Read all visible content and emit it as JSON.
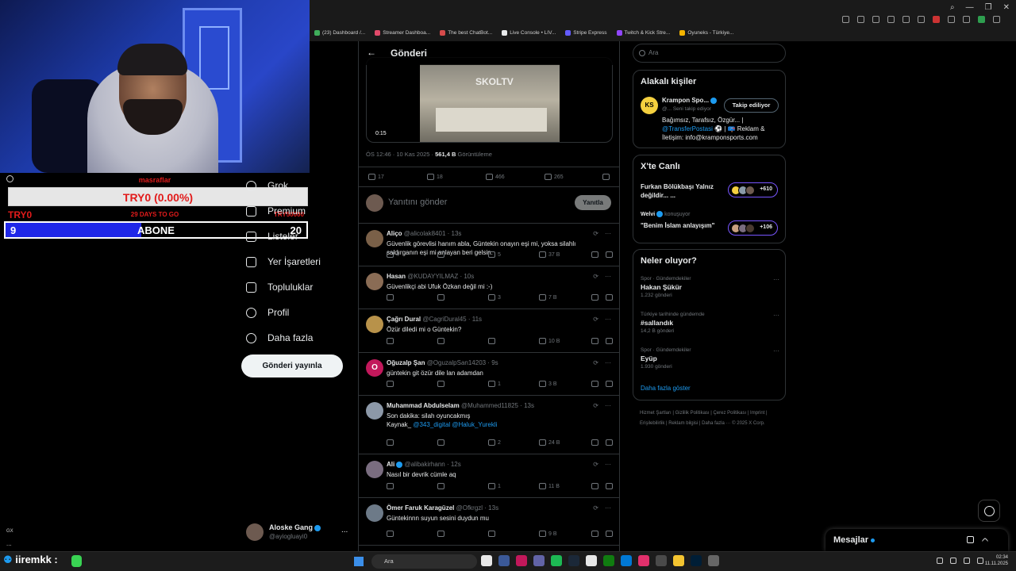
{
  "browser": {
    "bookmarks": [
      {
        "label": "(23) Dashboard /...",
        "color": "#3fae5a"
      },
      {
        "label": "Streamer Dashboa...",
        "color": "#e14a6a"
      },
      {
        "label": "The best ChatBot...",
        "color": "#d64b4b"
      },
      {
        "label": "Live Console • LIV...",
        "color": "#e7e9ea"
      },
      {
        "label": "Stripe Express",
        "color": "#635bff"
      },
      {
        "label": "Twitch & Kick Stre...",
        "color": "#9146ff"
      },
      {
        "label": "Oyuneks - Türkiye...",
        "color": "#f4b400"
      }
    ]
  },
  "overlay": {
    "goal_small": "masraflar",
    "goal_bar": "TRY0 (0.00%)",
    "goal_left": "TRY0",
    "goal_mid": "29 DAYS TO GO",
    "goal_right": "TRY50000",
    "sub_left": "9",
    "sub_mid": "ABONE",
    "sub_right": "20",
    "sub_progress": 0.45
  },
  "nav": {
    "items": [
      {
        "label": "Grok",
        "icon": "grok-icon"
      },
      {
        "label": "Premium",
        "icon": "x-icon"
      },
      {
        "label": "Listeler",
        "icon": "list-icon"
      },
      {
        "label": "Yer İşaretleri",
        "icon": "bookmark-icon"
      },
      {
        "label": "Topluluklar",
        "icon": "communities-icon"
      },
      {
        "label": "Profil",
        "icon": "profile-icon"
      },
      {
        "label": "Daha fazla",
        "icon": "more-icon"
      }
    ],
    "post_button": "Gönderi yayınla",
    "account_name": "Aloske Gang",
    "account_handle": "@ayiogluayi0",
    "account_more": "..."
  },
  "main": {
    "title": "Gönderi",
    "video_time": "0:15",
    "video_watermark": "SKOLTV",
    "meta_time": "ÖS 12:46 · 10 Kas 2025 · ",
    "meta_views": "561,4 B",
    "meta_views_label": " Görüntüleme",
    "stats": {
      "replies": "17",
      "reposts": "18",
      "likes": "466",
      "bookmarks": "265"
    },
    "reply_placeholder": "Yanıtını gönder",
    "reply_button": "Yanıtla",
    "replies": [
      {
        "name": "Aliço",
        "handle": "@alicolak8401 · 13s",
        "text": "Güvenlik görevlisi hanım abla, Güntekin onayın eşi mi, yoksa silahlı saldırganın eşi mi anlayan beri gelsin.",
        "replies": "4",
        "likes": "5",
        "views": "37 B",
        "avatar": "#7a6048"
      },
      {
        "name": "Hasan",
        "handle": "@KUDAYYILMAZ · 10s",
        "text": "Güvenlikçi abi Ufuk Özkan değil mi :-)",
        "replies": "",
        "likes": "3",
        "views": "7 B",
        "avatar": "#8a6c55"
      },
      {
        "name": "Çağrı Dural",
        "handle": "@CagriDural45 · 11s",
        "text": "Özür diledi mi o Güntekin?",
        "replies": "",
        "likes": "",
        "views": "10 B",
        "avatar": "#b8924a"
      },
      {
        "name": "Oğuzalp Şan",
        "handle": "@OguzalpSan14203 · 9s",
        "text": "güntekin git özür dile lan adamdan",
        "replies": "",
        "likes": "1",
        "views": "3 B",
        "avatar": "#c2185b",
        "letter": "O"
      },
      {
        "name": "Muhammad Abdulselam",
        "handle": "@Muhammed11825 · 13s",
        "text": "Son dakika:  silah oyuncakmış",
        "text2": "Kaynak_ ",
        "link": "@343_digital @Haluk_Yurekli",
        "replies": "",
        "likes": "2",
        "views": "24 B",
        "avatar": "#8c98a8"
      },
      {
        "name": "Ali",
        "handle": "@alibakirhann · 12s",
        "text": "Nasıl bir devrik cümle aq",
        "replies": "",
        "likes": "1",
        "views": "11 B",
        "avatar": "#7a6d80"
      },
      {
        "name": "Ömer Faruk Karagüzel",
        "handle": "@Ofkrgzl · 13s",
        "text": "Güntekinnn suyun sesini duydun mu",
        "replies": "",
        "likes": "",
        "views": "9 B",
        "avatar": "#6d7a88"
      }
    ]
  },
  "right": {
    "search_placeholder": "Ara",
    "related_title": "Alakalı kişiler",
    "related_name": "Krampon Spo...",
    "related_handle": "@... Seni takip ediyor",
    "related_avatar": "KS",
    "related_follow": "Takip ediliyor",
    "related_bio1": "Bağımsız, Tarafsız, Özgür... | ",
    "related_bio_link": "@TransferPostasi",
    "related_bio2": " ⚽ | 📪 Reklam & İletişim: info@kramponsports.com",
    "live_title": "X'te Canlı",
    "live1": "Furkan Bölükbaşı Yalnız değildir... ...",
    "live1_count": "+610",
    "live2_host": "Welvi",
    "live2_host_suffix": " konuşuyor",
    "live2": "\"Benim İslam anlayışım\"",
    "live2_count": "+106",
    "trends_title": "Neler oluyor?",
    "trends": [
      {
        "ctx": "Spor · Gündemdekiler",
        "name": "Hakan Şükür",
        "count": "1.232 gönderi"
      },
      {
        "ctx": "Türkiye tarihinde gündemde",
        "name": "#sallandık",
        "count": "14,2 B gönderi"
      },
      {
        "ctx": "Spor · Gündemdekiler",
        "name": "Eyüp",
        "count": "1.930 gönderi"
      }
    ],
    "trend_more": "···",
    "show_more": "Daha fazla göster",
    "footer": "Hizmet Şartları  |  Gizlilik Politikası  |  Çerez Politikası  |  Imprint  |  Erişilebilirlik  |  Reklam bilgisi  |  Daha fazla ···  © 2025 X Corp.",
    "messages": "Mesajlar"
  },
  "left_small": {
    "gx": "GX",
    "dots": "..."
  },
  "taskbar": {
    "chat_user": "iiremkk :",
    "search_placeholder": "Ara",
    "time": "02:34",
    "date": "11.11.2025",
    "apps": [
      "#e8e8e8",
      "#3b5998",
      "#c2185b",
      "#6264a7",
      "#1db954",
      "#1b2838",
      "#e7e7e7",
      "#107c10",
      "#0078d4",
      "#e1306c",
      "#4a4a4a",
      "#f4c430",
      "#001e36",
      "#666"
    ]
  }
}
